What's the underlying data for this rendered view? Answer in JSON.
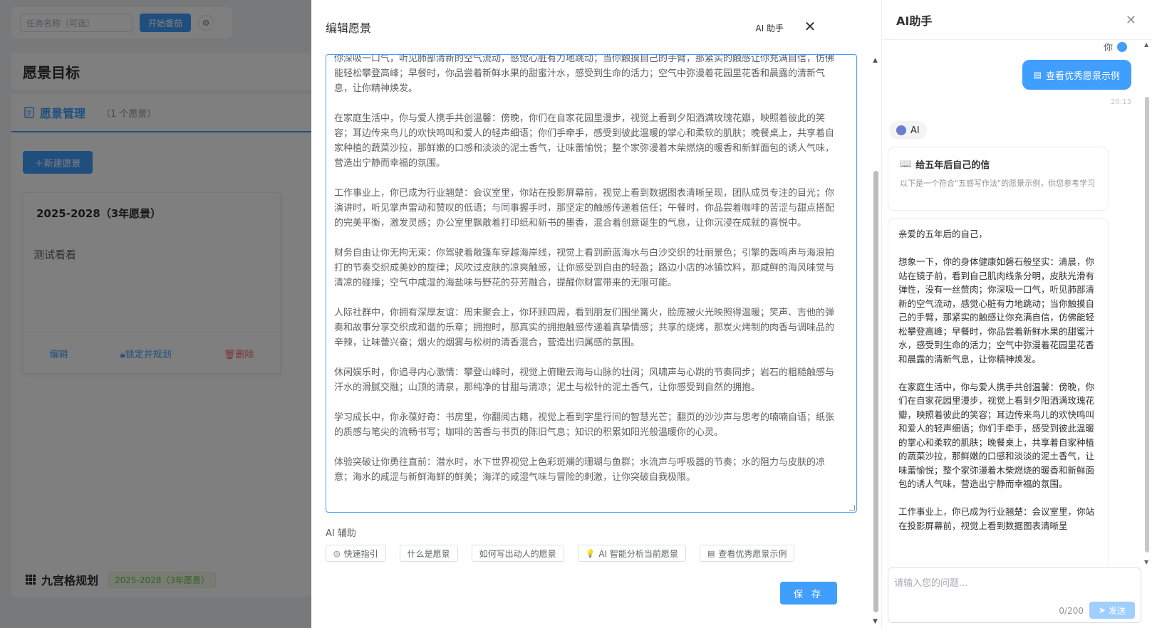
{
  "background": {
    "task_input_placeholder": "任务名称（可选）",
    "start_button": "开始番茄",
    "page_title": "愿景目标",
    "mgmt_tab_label": "愿景管理",
    "mgmt_count": "（1 个愿景）",
    "new_button": "＋新建愿景",
    "vision_card": {
      "title": "2025-2028（3年愿景）",
      "body": "测试看看",
      "edit": "编辑",
      "lock": "锁定并规划",
      "delete": "删除"
    },
    "grid_title": "九宫格规划",
    "grid_tag": "2025-2028（3年愿景）"
  },
  "drawer": {
    "title": "编辑愿景",
    "ai_help": "AI 助手",
    "paragraphs": [
      "想象一下，你的身体健康如磐石般坚实：清晨，你站在镜子前，看到自己肌肉线条分明，皮肤光滑有弹性，没有一丝赘肉；你深吸一口气，听见肺部清新的空气流动，感觉心脏有力地跳动；当你触摸自己的手臂，那紧实的触感让你充满自信，仿佛能轻松攀登高峰；早餐时，你品尝着新鲜水果的甜蜜汁水，感受到生命的活力；空气中弥漫着花园里花香和晨露的清新气息，让你精神焕发。",
      "在家庭生活中，你与爱人携手共创温馨：傍晚，你们在自家花园里漫步，视觉上看到夕阳洒满玫瑰花瓣，映照着彼此的笑容；耳边传来鸟儿的欢快鸣叫和爱人的轻声细语；你们手牵手，感受到彼此温暖的掌心和柔软的肌肤；晚餐桌上，共享着自家种植的蔬菜沙拉，那鲜嫩的口感和淡淡的泥土香气，让味蕾愉悦；整个家弥漫着木柴燃烧的暖香和新鲜面包的诱人气味，营造出宁静而幸福的氛围。",
      "工作事业上，你已成为行业翘楚：会议室里，你站在投影屏幕前，视觉上看到数据图表清晰呈现，团队成员专注的目光；你演讲时，听见掌声雷动和赞叹的低语；与同事握手时，那坚定的触感传递着信任；午餐时，你品尝着咖啡的苦涩与甜点搭配的完美平衡，激发灵感；办公室里飘散着打印纸和新书的墨香，混合着创意诞生的气息，让你沉浸在成就的喜悦中。",
      "财务自由让你无拘无束：你驾驶着敞篷车穿越海岸线，视觉上看到蔚蓝海水与白沙交织的壮丽景色；引擎的轰鸣声与海浪拍打的节奏交织成美妙的旋律；风吹过皮肤的凉爽触感，让你感受到自由的轻盈；路边小店的冰镇饮料，那咸鲜的海风味觉与清凉的碰撞；空气中咸湿的海盐味与野花的芬芳融合，提醒你财富带来的无限可能。",
      "人际社群中，你拥有深厚友谊：周末聚会上，你环顾四周，看到朋友们围坐篝火，脸庞被火光映照得温暖；笑声、吉他的弹奏和故事分享交织成和谐的乐章；拥抱时，那真实的拥抱触感传递着真挚情感；共享的烧烤，那炭火烤制的肉香与调味品的辛辣，让味蕾兴奋；烟火的烟雾与松树的清香混合，营造出归属感的氛围。",
      "休闲娱乐时，你追寻内心激情：攀登山峰时，视觉上俯瞰云海与山脉的壮阔；风啸声与心跳的节奏同步；岩石的粗糙触感与汗水的滑腻交融；山顶的清泉，那纯净的甘甜与清凉；泥土与松针的泥土香气，让你感受到自然的拥抱。",
      "学习成长中，你永葆好奇：书房里，你翻阅古籍，视觉上看到字里行间的智慧光芒；翻页的沙沙声与思考的喃喃自语；纸张的质感与笔尖的流畅书写；咖啡的苦香与书页的陈旧气息；知识的积累如阳光般温暖你的心灵。",
      "体验突破让你勇往直前：潜水时，水下世界视觉上色彩斑斓的珊瑚与鱼群；水流声与呼吸器的节奏；水的阻力与皮肤的凉意；海水的咸涩与新鲜海鲜的鲜美；海洋的咸湿气味与冒险的刺激，让你突破自我极限。"
    ],
    "ai_section_label": "AI 辅助",
    "chips": [
      {
        "icon": "target-icon",
        "glyph": "◎",
        "label": "快速指引"
      },
      {
        "icon": "",
        "glyph": "",
        "label": "什么是愿景"
      },
      {
        "icon": "",
        "glyph": "",
        "label": "如何写出动人的愿景"
      },
      {
        "icon": "bulb-icon",
        "glyph": "💡",
        "label": "AI 智能分析当前愿景"
      },
      {
        "icon": "document-icon",
        "glyph": "▤",
        "label": "查看优秀愿景示例"
      }
    ],
    "save_button": "保 存"
  },
  "ai_panel": {
    "title": "AI助手",
    "you_label": "你",
    "user_message": "查看优秀愿景示例",
    "user_time": "20:13",
    "ai_label": "AI",
    "letter_title": "给五年后自己的信",
    "letter_sub": "以下是一个符合\"五感写作法\"的愿景示例，供您参考学习",
    "message_paragraphs": [
      "亲爱的五年后的自己，",
      "想象一下，你的身体健康如磐石般坚实：清晨，你站在镜子前，看到自己肌肉线条分明，皮肤光滑有弹性，没有一丝赘肉；你深吸一口气，听见肺部清新的空气流动，感觉心脏有力地跳动；当你触摸自己的手臂，那紧实的触感让你充满自信，仿佛能轻松攀登高峰；早餐时，你品尝着新鲜水果的甜蜜汁水，感受到生命的活力；空气中弥漫着花园里花香和晨露的清新气息，让你精神焕发。",
      "在家庭生活中，你与爱人携手共创温馨：傍晚，你们在自家花园里漫步，视觉上看到夕阳洒满玫瑰花瓣，映照着彼此的笑容；耳边传来鸟儿的欢快鸣叫和爱人的轻声细语；你们手牵手，感受到彼此温暖的掌心和柔软的肌肤；晚餐桌上，共享着自家种植的蔬菜沙拉，那鲜嫩的口感和淡淡的泥土香气，让味蕾愉悦；整个家弥漫着木柴燃烧的暖香和新鲜面包的诱人气味，营造出宁静而幸福的氛围。",
      "工作事业上，你已成为行业翘楚：会议室里，你站在投影屏幕前，视觉上看到数据图表清晰呈"
    ],
    "input_placeholder": "请输入您的问题...",
    "input_count": "0/200",
    "send_button": "发送"
  },
  "colors": {
    "primary": "#409eff",
    "danger": "#f56c6c",
    "success": "#67c23a"
  }
}
